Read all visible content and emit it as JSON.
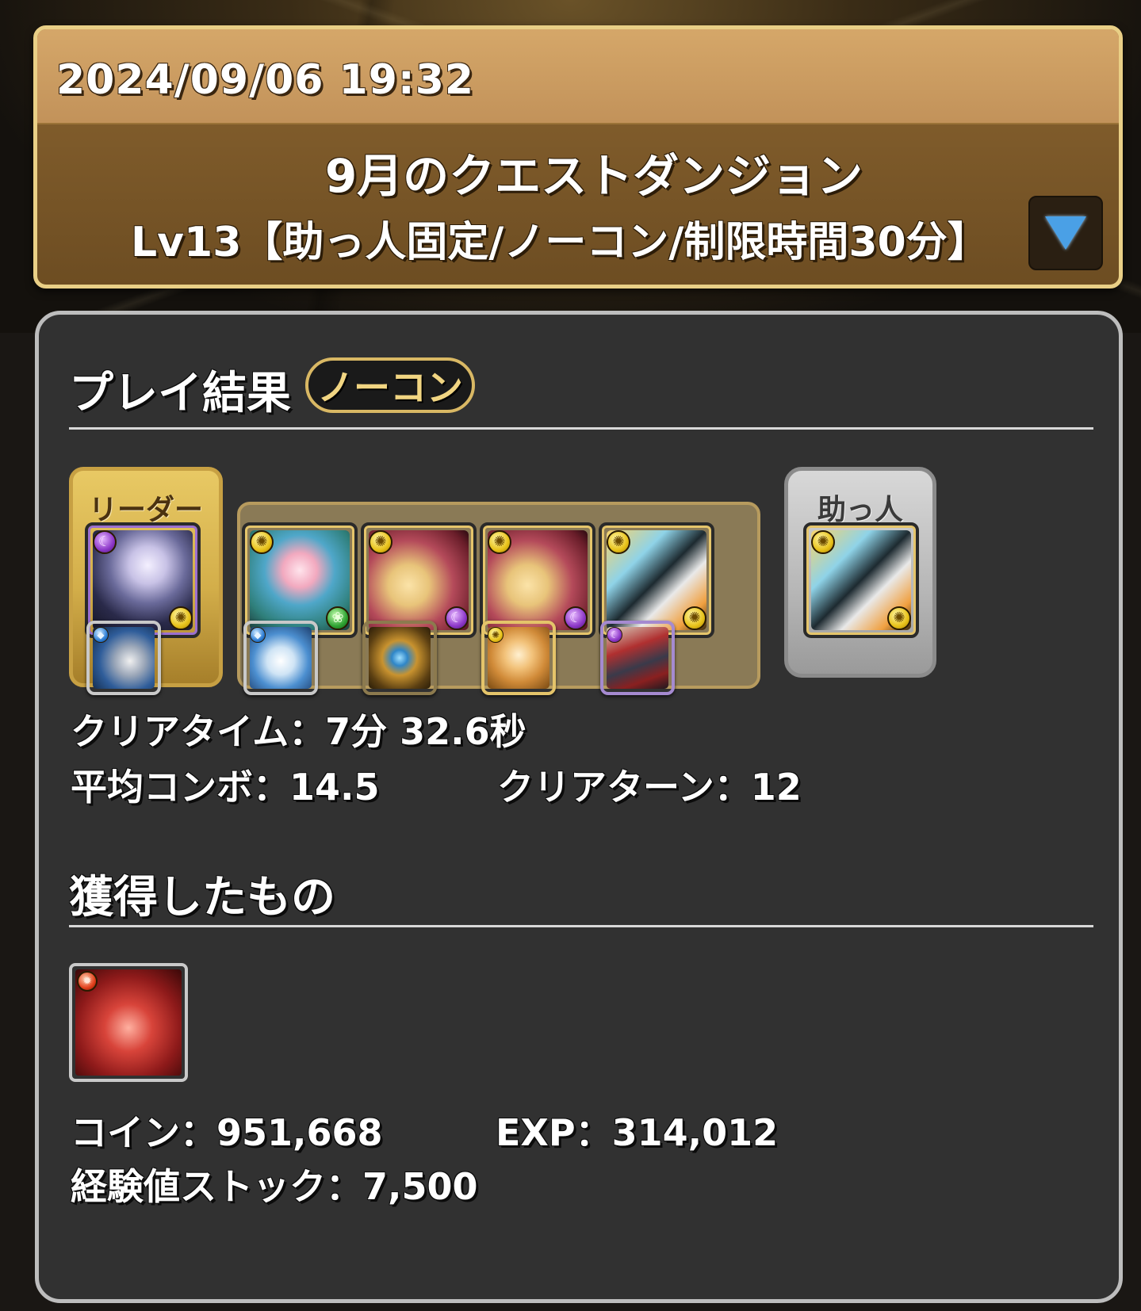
{
  "header": {
    "date": "2024/09/06 19:32",
    "title": "9月のクエストダンジョン",
    "subtitle": "Lv13【助っ人固定/ノーコン/制限時間30分】",
    "dropdown_icon": "triangle-down-icon"
  },
  "result": {
    "section_title": "プレイ結果",
    "badge": "ノーコン",
    "leader_label": "リーダー",
    "helper_label": "助っ人",
    "leader": {
      "main_attr": "dark",
      "sub_attr": "light",
      "name": "leader-card",
      "assist_attr": "water"
    },
    "subs": [
      {
        "main_attr": "light",
        "sub_attr": "wood",
        "assist_attr": "water"
      },
      {
        "main_attr": "light",
        "sub_attr": "dark",
        "assist_attr": "none"
      },
      {
        "main_attr": "light",
        "sub_attr": "dark",
        "assist_attr": "light"
      },
      {
        "main_attr": "light",
        "sub_attr": "light",
        "assist_attr": "dark"
      }
    ],
    "helper": {
      "main_attr": "light",
      "sub_attr": "light"
    },
    "clear_time_label": "クリアタイム：7分 32.6秒",
    "avg_combo_label": "平均コンボ：14.5",
    "clear_turn_label": "クリアターン：12"
  },
  "rewards": {
    "section_title": "獲得したもの",
    "drop_attr": "fire",
    "coin_label": "コイン：951,668",
    "exp_label": "EXP：314,012",
    "stock_label": "経験値ストック：7,500"
  },
  "colors": {
    "header_border": "#e9cf86",
    "header_top": "#d5a769",
    "header_body": "#7a5627",
    "panel_bg": "#313131",
    "panel_border": "#bdbdbd",
    "badge_text": "#f1d582",
    "dropdown_arrow": "#4aa0e6"
  }
}
